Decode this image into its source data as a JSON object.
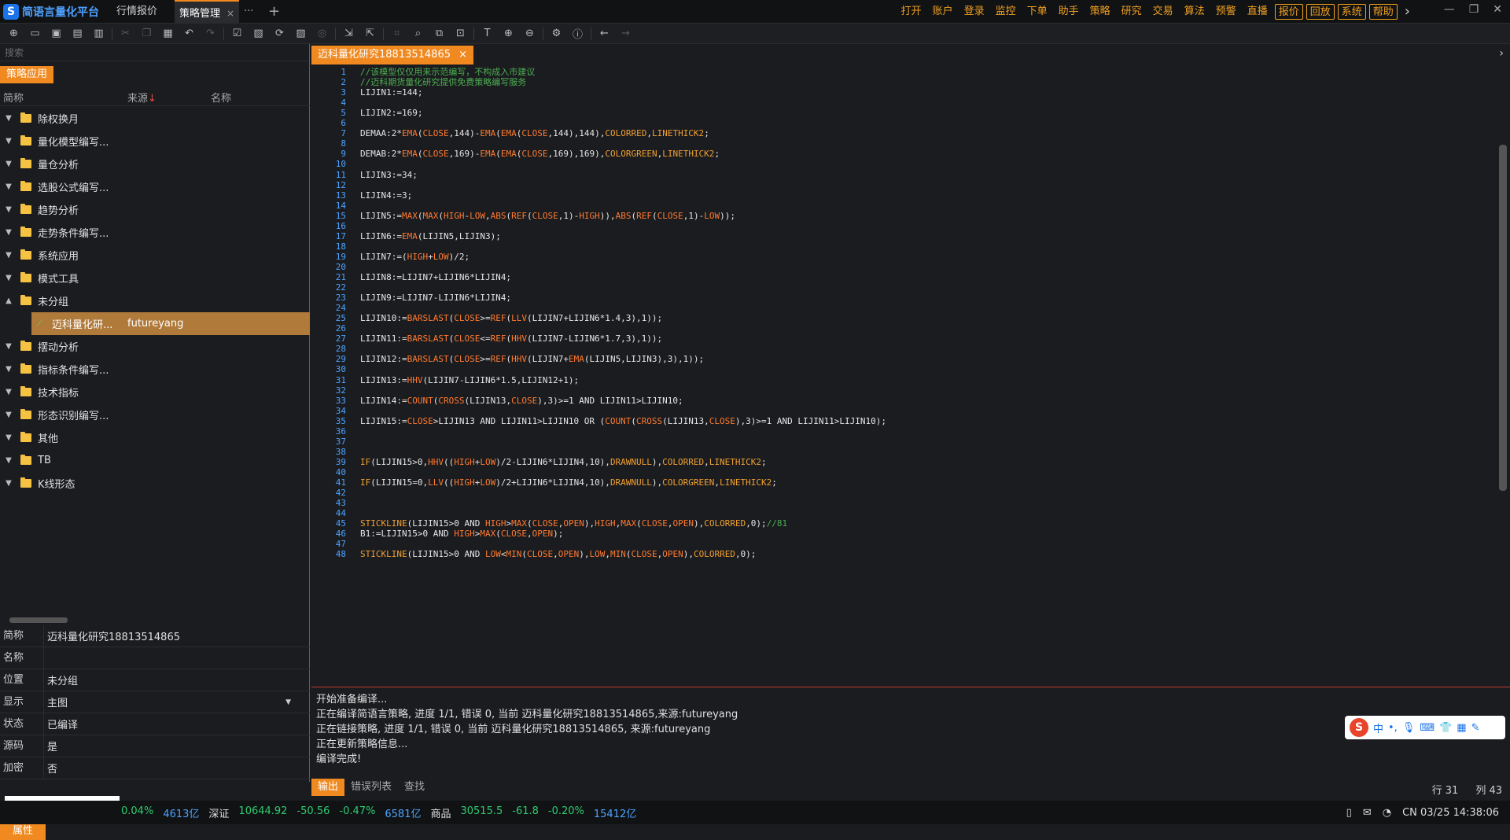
{
  "app": {
    "title": "简语言量化平台",
    "logo_letter": "S"
  },
  "tabs": [
    {
      "label": "行情报价"
    },
    {
      "label": "策略管理",
      "close": "×"
    }
  ],
  "tab_more": "···",
  "tab_add": "+",
  "menu": [
    "打开",
    "账户",
    "登录",
    "监控",
    "下单",
    "助手",
    "策略",
    "研究",
    "交易",
    "算法",
    "预警",
    "直播"
  ],
  "menu_boxed": [
    "报价",
    "回放",
    "系统",
    "帮助"
  ],
  "window_controls": [
    "—",
    "❐",
    "✕"
  ],
  "left": {
    "search_placeholder": "搜索",
    "app_tab": "策略应用",
    "columns": {
      "abbr": "简称",
      "source": "来源",
      "source_sort": "↓",
      "name": "名称"
    },
    "tree": [
      {
        "label": "除权换月"
      },
      {
        "label": "量化模型编写..."
      },
      {
        "label": "量仓分析"
      },
      {
        "label": "选股公式编写..."
      },
      {
        "label": "趋势分析"
      },
      {
        "label": "走势条件编写..."
      },
      {
        "label": "系统应用"
      },
      {
        "label": "模式工具"
      },
      {
        "label": "未分组"
      },
      {
        "label": "迈科量化研...",
        "source": "futureyang"
      },
      {
        "label": "摆动分析"
      },
      {
        "label": "指标条件编写..."
      },
      {
        "label": "技术指标"
      },
      {
        "label": "形态识别编写..."
      },
      {
        "label": "其他"
      },
      {
        "label": "TB"
      },
      {
        "label": "K线形态"
      }
    ],
    "props": [
      {
        "k": "简称",
        "v": "迈科量化研究18813514865"
      },
      {
        "k": "名称",
        "v": ""
      },
      {
        "k": "位置",
        "v": "未分组"
      },
      {
        "k": "显示",
        "v": "主图"
      },
      {
        "k": "状态",
        "v": "已编译"
      },
      {
        "k": "源码",
        "v": "是"
      },
      {
        "k": "加密",
        "v": "否"
      }
    ],
    "attr_tab": "属性"
  },
  "editor": {
    "tab_label": "迈科量化研究18813514865",
    "tab_close": "×",
    "lines": [
      {
        "n": "1",
        "t": "//该模型仅仅用来示范编写，不构成入市建议",
        "c": true
      },
      {
        "n": "2",
        "t": "//迈科期货量化研究提供免费策略编写服务",
        "c": true
      },
      {
        "n": "3",
        "t": "LIJIN1:=144;"
      },
      {
        "n": "4",
        "t": ""
      },
      {
        "n": "5",
        "t": "LIJIN2:=169;"
      },
      {
        "n": "6",
        "t": ""
      },
      {
        "n": "7",
        "t": "DEMAA:2*EMA(CLOSE,144)-EMA(EMA(CLOSE,144),144),COLORRED,LINETHICK2;"
      },
      {
        "n": "8",
        "t": ""
      },
      {
        "n": "9",
        "t": "DEMAB:2*EMA(CLOSE,169)-EMA(EMA(CLOSE,169),169),COLORGREEN,LINETHICK2;"
      },
      {
        "n": "10",
        "t": ""
      },
      {
        "n": "11",
        "t": "LIJIN3:=34;"
      },
      {
        "n": "12",
        "t": ""
      },
      {
        "n": "13",
        "t": "LIJIN4:=3;"
      },
      {
        "n": "14",
        "t": ""
      },
      {
        "n": "15",
        "t": "LIJIN5:=MAX(MAX(HIGH-LOW,ABS(REF(CLOSE,1)-HIGH)),ABS(REF(CLOSE,1)-LOW));"
      },
      {
        "n": "16",
        "t": ""
      },
      {
        "n": "17",
        "t": "LIJIN6:=EMA(LIJIN5,LIJIN3);"
      },
      {
        "n": "18",
        "t": ""
      },
      {
        "n": "19",
        "t": "LIJIN7:=(HIGH+LOW)/2;"
      },
      {
        "n": "20",
        "t": ""
      },
      {
        "n": "21",
        "t": "LIJIN8:=LIJIN7+LIJIN6*LIJIN4;"
      },
      {
        "n": "22",
        "t": ""
      },
      {
        "n": "23",
        "t": "LIJIN9:=LIJIN7-LIJIN6*LIJIN4;"
      },
      {
        "n": "24",
        "t": ""
      },
      {
        "n": "25",
        "t": "LIJIN10:=BARSLAST(CLOSE>=REF(LLV(LIJIN7+LIJIN6*1.4,3),1));"
      },
      {
        "n": "26",
        "t": ""
      },
      {
        "n": "27",
        "t": "LIJIN11:=BARSLAST(CLOSE<=REF(HHV(LIJIN7-LIJIN6*1.7,3),1));"
      },
      {
        "n": "28",
        "t": ""
      },
      {
        "n": "29",
        "t": "LIJIN12:=BARSLAST(CLOSE>=REF(HHV(LIJIN7+EMA(LIJIN5,LIJIN3),3),1));"
      },
      {
        "n": "30",
        "t": ""
      },
      {
        "n": "31",
        "t": "LIJIN13:=HHV(LIJIN7-LIJIN6*1.5,LIJIN12+1);"
      },
      {
        "n": "32",
        "t": ""
      },
      {
        "n": "33",
        "t": "LIJIN14:=COUNT(CROSS(LIJIN13,CLOSE),3)>=1 AND LIJIN11>LIJIN10;"
      },
      {
        "n": "34",
        "t": ""
      },
      {
        "n": "35",
        "t": "LIJIN15:=CLOSE>LIJIN13 AND LIJIN11>LIJIN10 OR (COUNT(CROSS(LIJIN13,CLOSE),3)>=1 AND LIJIN11>LIJIN10);"
      },
      {
        "n": "36",
        "t": ""
      },
      {
        "n": "37",
        "t": ""
      },
      {
        "n": "38",
        "t": ""
      },
      {
        "n": "39",
        "t": "IF(LIJIN15>0,HHV((HIGH+LOW)/2-LIJIN6*LIJIN4,10),DRAWNULL),COLORRED,LINETHICK2;"
      },
      {
        "n": "40",
        "t": ""
      },
      {
        "n": "41",
        "t": "IF(LIJIN15=0,LLV((HIGH+LOW)/2+LIJIN6*LIJIN4,10),DRAWNULL),COLORGREEN,LINETHICK2;"
      },
      {
        "n": "42",
        "t": ""
      },
      {
        "n": "43",
        "t": ""
      },
      {
        "n": "44",
        "t": ""
      },
      {
        "n": "45",
        "t": "STICKLINE(LIJIN15>0 AND HIGH>MAX(CLOSE,OPEN),HIGH,MAX(CLOSE,OPEN),COLORRED,0);//81"
      },
      {
        "n": "46",
        "t": "B1:=LIJIN15>0 AND HIGH>MAX(CLOSE,OPEN);"
      },
      {
        "n": "47",
        "t": ""
      },
      {
        "n": "48",
        "t": "STICKLINE(LIJIN15>0 AND LOW<MIN(CLOSE,OPEN),LOW,MIN(CLOSE,OPEN),COLORRED,0);"
      }
    ],
    "keywords": [
      "EMA",
      "MAX",
      "ABS",
      "REF",
      "BARSLAST",
      "LLV",
      "HHV",
      "COUNT",
      "CROSS",
      "IF",
      "STICKLINE",
      "MIN",
      "HIGH",
      "LOW",
      "CLOSE",
      "OPEN",
      "COLORRED",
      "COLORGREEN",
      "LINETHICK2",
      "DRAWNULL"
    ]
  },
  "output": {
    "lines": [
      "开始准备编译...",
      "正在编译简语言策略, 进度 1/1, 错误 0, 当前 迈科量化研究18813514865,来源:futureyang",
      "正在链接策略, 进度 1/1, 错误 0, 当前 迈科量化研究18813514865, 来源:futureyang",
      "正在更新策略信息...",
      "编译完成!"
    ],
    "tabs": [
      "输出",
      "错误列表",
      "查找"
    ],
    "row": "行 31",
    "col": "列 43"
  },
  "ime": {
    "logo": "S",
    "lang": "中"
  },
  "status": {
    "items": [
      {
        "t": "0.04%",
        "cls": "g"
      },
      {
        "t": "4613亿",
        "cls": "c"
      },
      {
        "t": "深证",
        "cls": "w"
      },
      {
        "t": "10644.92",
        "cls": "g"
      },
      {
        "t": "-50.56",
        "cls": "g"
      },
      {
        "t": "-0.47%",
        "cls": "g"
      },
      {
        "t": "6581亿",
        "cls": "c"
      },
      {
        "t": "商品",
        "cls": "w"
      },
      {
        "t": "30515.5",
        "cls": "g"
      },
      {
        "t": "-61.8",
        "cls": "g"
      },
      {
        "t": "-0.20%",
        "cls": "g"
      },
      {
        "t": "15412亿",
        "cls": "c"
      }
    ],
    "clock": "CN 03/25 14:38:06"
  }
}
